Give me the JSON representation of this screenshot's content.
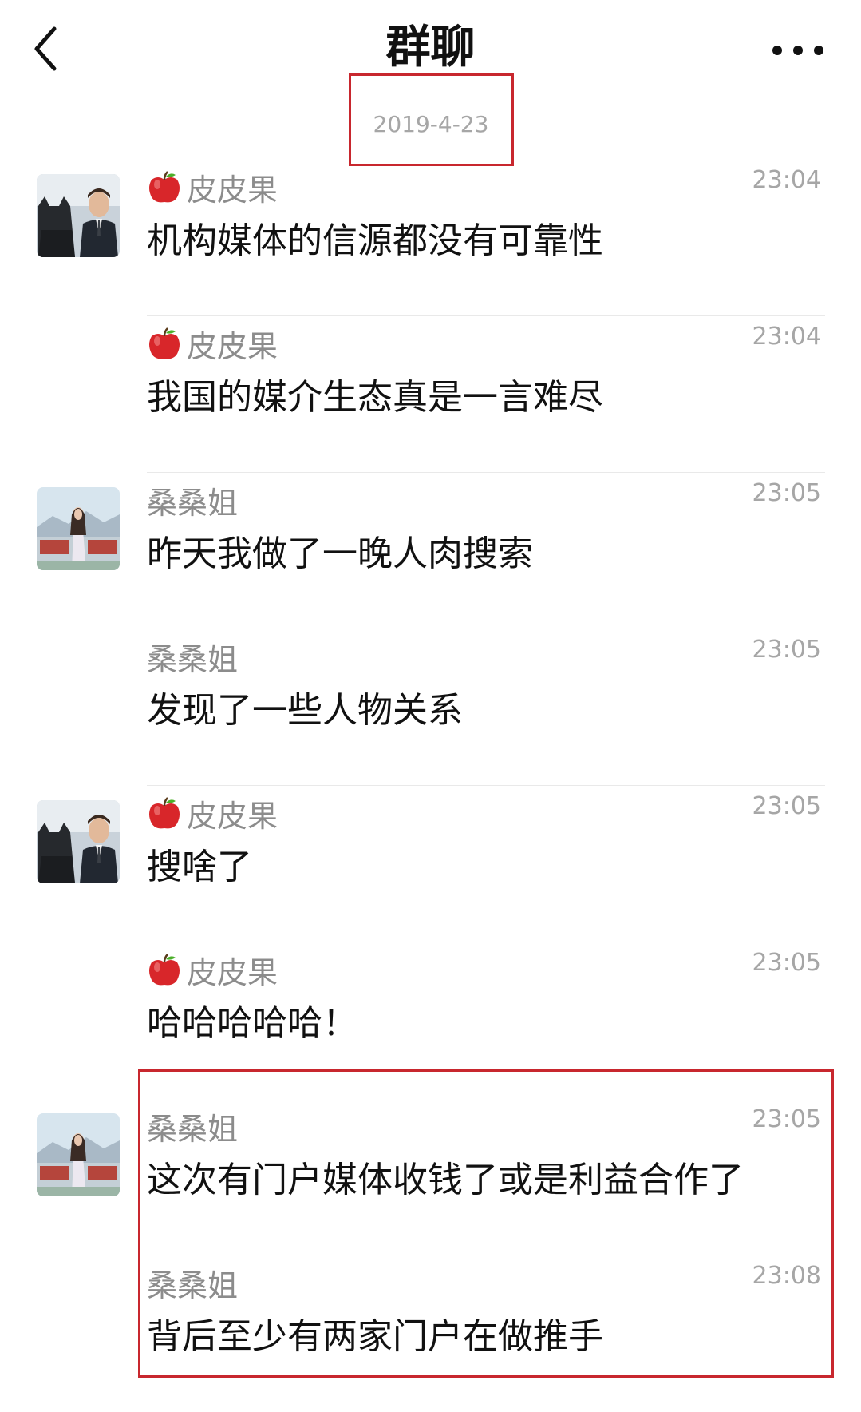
{
  "header": {
    "title": "群聊",
    "back_icon": "chevron-left-icon",
    "more_icon": "more-dots-icon"
  },
  "date_divider": {
    "text": "2019-4-23"
  },
  "colors": {
    "highlight": "#c8272e",
    "meta": "#a6a6a6",
    "sender": "#8c8c8c",
    "text": "#111111"
  },
  "messages": [
    {
      "sender": "皮皮果",
      "sender_prefix_icon": "apple-icon",
      "time": "23:04",
      "text": "机构媒体的信源都没有可靠性",
      "avatar": "batman-avatar"
    },
    {
      "sender": "皮皮果",
      "sender_prefix_icon": "apple-icon",
      "time": "23:04",
      "text": "我国的媒介生态真是一言难尽"
    },
    {
      "sender": "桑桑姐",
      "time": "23:05",
      "text": "昨天我做了一晚人肉搜索",
      "avatar": "girl-avatar"
    },
    {
      "sender": "桑桑姐",
      "time": "23:05",
      "text": "发现了一些人物关系"
    },
    {
      "sender": "皮皮果",
      "sender_prefix_icon": "apple-icon",
      "time": "23:05",
      "text": "搜啥了",
      "avatar": "batman-avatar"
    },
    {
      "sender": "皮皮果",
      "sender_prefix_icon": "apple-icon",
      "time": "23:05",
      "text": "哈哈哈哈哈！"
    },
    {
      "sender": "桑桑姐",
      "time": "23:05",
      "text": "这次有门户媒体收钱了或是利益合作了",
      "avatar": "girl-avatar"
    },
    {
      "sender": "桑桑姐",
      "time": "23:08",
      "text": "背后至少有两家门户在做推手"
    }
  ]
}
